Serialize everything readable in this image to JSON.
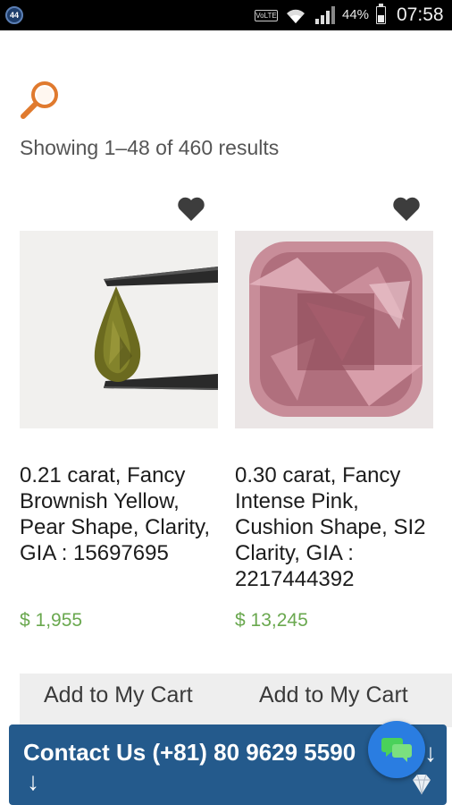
{
  "status_bar": {
    "notification_badge": "44",
    "volte_label": "VoLTE",
    "battery_percent": "44%",
    "battery_level": 0.44,
    "time": "07:58",
    "icons": [
      "notification-icon",
      "volte-icon",
      "wifi-icon",
      "signal-icon",
      "battery-icon"
    ]
  },
  "search": {
    "icon": "search-icon",
    "accent_color": "#e07a2e"
  },
  "results": {
    "text": "Showing 1–48 of 460 results"
  },
  "products": [
    {
      "title": "0.21 carat, Fancy Brownish Yellow, Pear Shape, Clarity, GIA : 15697695",
      "price": "$ 1,955",
      "cart_label": "Add to My Cart",
      "wishlist_icon": "heart-icon"
    },
    {
      "title": "0.30 carat, Fancy Intense Pink, Cushion Shape, SI2 Clarity, GIA : 2217444392",
      "price": "$ 13,245",
      "cart_label": "Add to My Cart",
      "wishlist_icon": "heart-icon"
    }
  ],
  "contact": {
    "text": "Contact Us (+81) 80 9629 5590",
    "arrow": "↓",
    "bar_color": "#245a8c"
  },
  "chat": {
    "icon": "chat-icon",
    "color": "#2a7de1"
  },
  "colors": {
    "price": "#6aa84f",
    "cart_bar": "#eeeeee"
  }
}
